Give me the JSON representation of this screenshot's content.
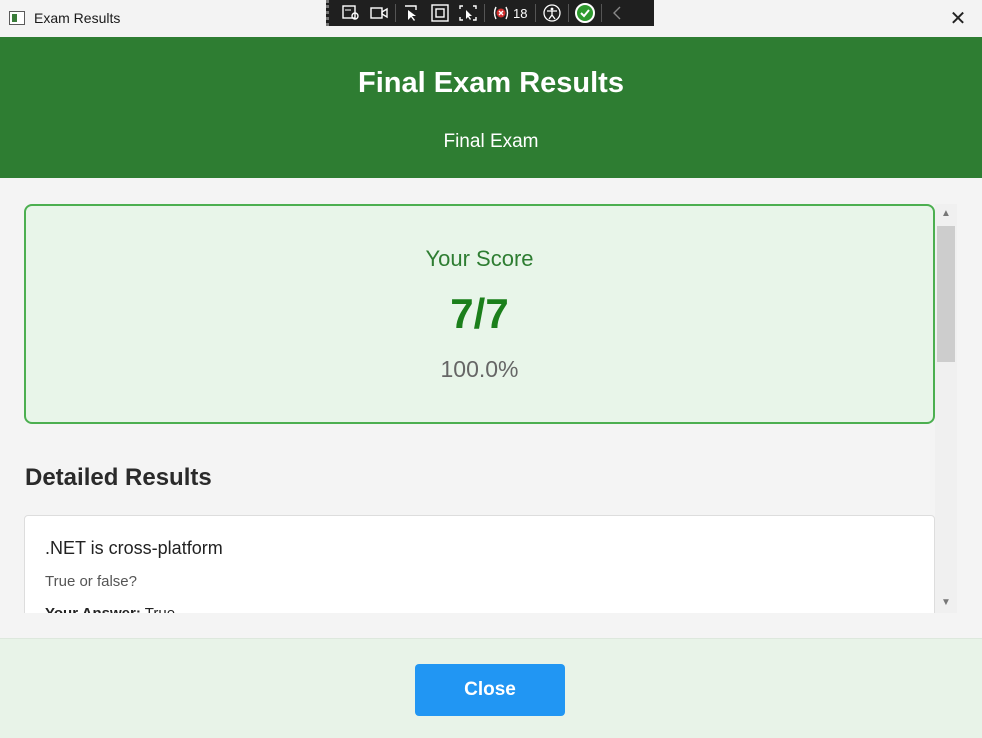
{
  "window": {
    "title": "Exam Results",
    "close_glyph": "✕"
  },
  "debug_toolbar": {
    "visual_tree_count": "18",
    "icons": [
      "live-visual-tree-icon",
      "record-icon",
      "select-element-icon",
      "display-layout-adorners-icon",
      "track-focus-icon",
      "binding-failures-icon",
      "accessibility-icon",
      "checked-icon",
      "collapse-icon"
    ]
  },
  "header": {
    "title": "Final Exam Results",
    "subtitle": "Final Exam",
    "background": "#2e7d32"
  },
  "score": {
    "label": "Your Score",
    "value": "7/7",
    "percent": "100.0%",
    "accent": "#4caf50"
  },
  "details": {
    "title": "Detailed Results",
    "questions": [
      {
        "title": ".NET is cross-platform",
        "description": "True or false?",
        "answer_label": "Your Answer:",
        "answer_value": "True"
      }
    ]
  },
  "footer": {
    "close_label": "Close",
    "button_color": "#2196f3"
  }
}
